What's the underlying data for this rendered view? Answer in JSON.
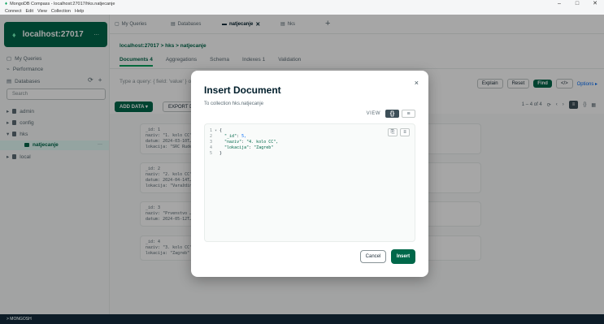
{
  "window": {
    "title": "MongoDB Compass - localhost:27017/hks.natjecanje",
    "controls": [
      "–",
      "□",
      "✕"
    ]
  },
  "menu": [
    "Connect",
    "Edit",
    "View",
    "Collection",
    "Help"
  ],
  "connection": {
    "name": "localhost:27017",
    "more": "..."
  },
  "sidebar": {
    "my_queries": "My Queries",
    "performance": "Performance",
    "databases": "Databases",
    "search_placeholder": "Search",
    "tree": [
      {
        "label": "admin"
      },
      {
        "label": "config"
      },
      {
        "label": "hks"
      },
      {
        "label": "local"
      }
    ],
    "selected_collection": "natjecanje"
  },
  "tabs": [
    {
      "label": "My Queries"
    },
    {
      "label": "Databases"
    },
    {
      "label": "natjecanje",
      "active": true
    },
    {
      "label": "hks"
    }
  ],
  "breadcrumb": "localhost:27017 > hks > natjecanje",
  "subtabs": {
    "documents": "Documents",
    "documents_count": "4",
    "aggregations": "Aggregations",
    "schema": "Schema",
    "indexes": "Indexes",
    "indexes_count": "1",
    "validation": "Validation"
  },
  "filter": {
    "placeholder": "Type a query: { field: 'value' } or Generate query",
    "explain": "Explain",
    "reset": "Reset",
    "find": "Find",
    "options": "Options ▸"
  },
  "actions": {
    "add_data": "ADD DATA ▾",
    "export": "EXPORT DATA ▾"
  },
  "pager": {
    "range": "1 – 4 of 4"
  },
  "documents": [
    [
      "_id: 1",
      "naziv: \"1. kolo CC\"",
      "datum: 2024-03-10T…",
      "lokacija: \"SRC Rudeš\""
    ],
    [
      "_id: 2",
      "naziv: \"2. kolo CC\"",
      "datum: 2024-04-14T…",
      "lokacija: \"Varaždin\""
    ],
    [
      "_id: 3",
      "naziv: \"Prvenstvo …\"",
      "datum: 2024-05-12T…"
    ],
    [
      "_id: 4",
      "naziv: \"3. kolo CC\"",
      "lokacija: \"Zagreb\""
    ]
  ],
  "status": "> MONGOSH",
  "modal": {
    "title": "Insert Document",
    "subtitle": "To collection hks.natjecanje",
    "view_label": "VIEW",
    "view_json": "{}",
    "view_list": "≡",
    "close": "×",
    "code": [
      {
        "ln": "1 ▾",
        "text": "{"
      },
      {
        "ln": "2",
        "key": "\"_id\"",
        "val": "5,"
      },
      {
        "ln": "3",
        "key": "\"naziv\"",
        "val": "\"4. kolo CC\","
      },
      {
        "ln": "4",
        "key": "\"lokacija\"",
        "val": "\"Zagreb\""
      },
      {
        "ln": "5",
        "text": "}"
      }
    ],
    "cancel": "Cancel",
    "insert": "Insert"
  }
}
